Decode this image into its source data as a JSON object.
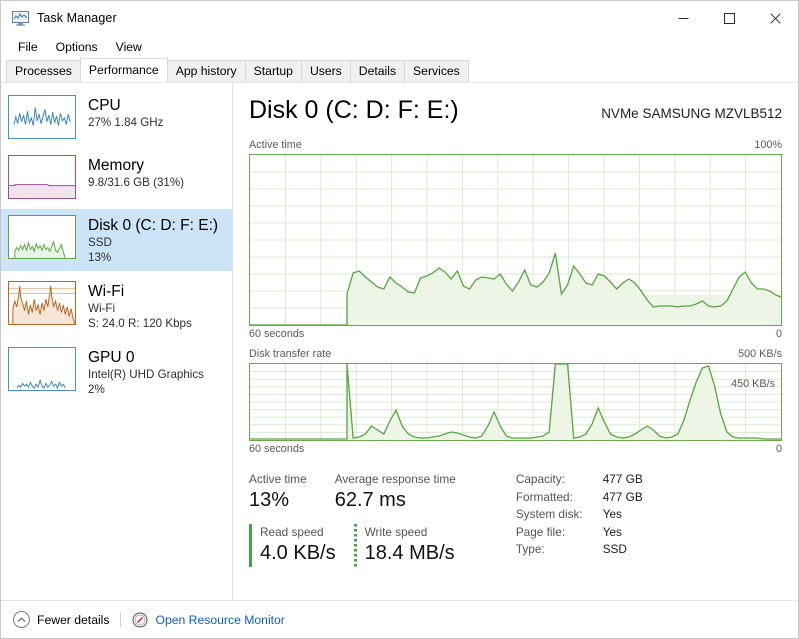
{
  "window": {
    "title": "Task Manager",
    "icon": "task-manager-icon",
    "caption": {
      "minimize": "—",
      "maximize": "☐",
      "close": "✕"
    }
  },
  "menu": {
    "items": [
      {
        "label": "File"
      },
      {
        "label": "Options"
      },
      {
        "label": "View"
      }
    ]
  },
  "tabs": {
    "active": "Performance",
    "items": [
      {
        "label": "Processes"
      },
      {
        "label": "Performance"
      },
      {
        "label": "App history"
      },
      {
        "label": "Startup"
      },
      {
        "label": "Users"
      },
      {
        "label": "Details"
      },
      {
        "label": "Services"
      }
    ]
  },
  "sidebar": {
    "items": [
      {
        "title": "CPU",
        "sub1": "27%  1.84 GHz",
        "sub2": "",
        "color": "#4a90c4",
        "selected": false
      },
      {
        "title": "Memory",
        "sub1": "9.8/31.6 GB (31%)",
        "sub2": "",
        "color": "#9b4f96",
        "selected": false
      },
      {
        "title": "Disk 0 (C: D: F: E:)",
        "sub1": "SSD",
        "sub2": "13%",
        "color": "#5aa544",
        "selected": true
      },
      {
        "title": "Wi-Fi",
        "sub1": "Wi-Fi",
        "sub2": "S: 24.0 R: 120 Kbps",
        "color": "#b5651d",
        "selected": false
      },
      {
        "title": "GPU 0",
        "sub1": "Intel(R) UHD Graphics",
        "sub2": "2%",
        "color": "#4a90c4",
        "selected": false
      }
    ]
  },
  "main": {
    "title": "Disk 0 (C: D: F: E:)",
    "subtitle": "NVMe SAMSUNG MZVLB512",
    "graph1": {
      "label": "Active time",
      "max_label": "100%",
      "left_time": "60 seconds",
      "right_time": "0"
    },
    "graph2": {
      "label": "Disk transfer rate",
      "max_label": "500 KB/s",
      "annotation": "450 KB/s",
      "left_time": "60 seconds",
      "right_time": "0"
    },
    "stats": {
      "active_time_label": "Active time",
      "active_time_value": "13%",
      "avg_response_label": "Average response time",
      "avg_response_value": "62.7 ms",
      "read_label": "Read speed",
      "read_value": "4.0 KB/s",
      "write_label": "Write speed",
      "write_value": "18.4 MB/s"
    },
    "info": [
      {
        "key": "Capacity:",
        "value": "477 GB"
      },
      {
        "key": "Formatted:",
        "value": "477 GB"
      },
      {
        "key": "System disk:",
        "value": "Yes"
      },
      {
        "key": "Page file:",
        "value": "Yes"
      },
      {
        "key": "Type:",
        "value": "SSD"
      }
    ]
  },
  "footer": {
    "fewer_details": "Fewer details",
    "resource_monitor": "Open Resource Monitor"
  },
  "colors": {
    "accent_green": "#6aa84f",
    "graph_fill": "#e8f3e2",
    "selection": "#cce4f7",
    "link": "#0a5fbf"
  },
  "chart_data": [
    {
      "type": "area",
      "title": "Active time",
      "ylabel": "%",
      "ylim": [
        0,
        100
      ],
      "xlabel": "seconds ago",
      "xlim": [
        60,
        0
      ],
      "grid": true,
      "values": [
        0,
        0,
        0,
        0,
        0,
        0,
        0,
        0,
        0,
        0,
        0,
        0,
        0,
        0,
        0,
        0,
        0,
        0,
        0,
        0,
        0,
        0,
        0,
        0,
        0,
        0,
        18,
        19,
        16,
        14,
        11,
        10,
        16,
        11,
        9,
        7,
        6,
        13,
        14,
        16,
        20,
        18,
        15,
        19,
        12,
        10,
        13,
        14,
        14,
        13,
        16,
        11,
        8,
        12,
        17,
        11,
        10,
        12,
        15,
        22,
        33,
        7,
        12,
        23,
        19,
        13,
        12,
        18,
        17,
        13,
        9,
        13,
        15,
        13,
        8,
        3,
        0,
        1,
        1,
        1,
        0,
        1,
        1,
        2,
        4,
        1,
        0,
        1,
        3,
        9,
        16,
        20,
        13
      ]
    },
    {
      "type": "area",
      "title": "Disk transfer rate",
      "ylabel": "KB/s",
      "ylim": [
        0,
        500
      ],
      "xlabel": "seconds ago",
      "xlim": [
        60,
        0
      ],
      "grid": true,
      "annotation": "450 KB/s",
      "values": [
        0,
        0,
        0,
        0,
        0,
        0,
        0,
        0,
        0,
        0,
        0,
        0,
        0,
        0,
        0,
        0,
        0,
        20,
        40,
        90,
        60,
        40,
        130,
        230,
        110,
        50,
        20,
        15,
        15,
        20,
        25,
        35,
        60,
        70,
        45,
        25,
        20,
        20,
        15,
        25,
        80,
        190,
        90,
        25,
        15,
        12,
        12,
        12,
        15,
        14,
        500,
        500,
        500,
        14,
        12,
        20,
        60,
        200,
        100,
        35,
        20,
        15,
        14,
        40,
        75,
        95,
        60,
        20,
        14,
        12,
        14,
        60,
        200,
        380,
        460,
        420,
        230,
        60,
        18,
        12,
        10
      ]
    }
  ]
}
